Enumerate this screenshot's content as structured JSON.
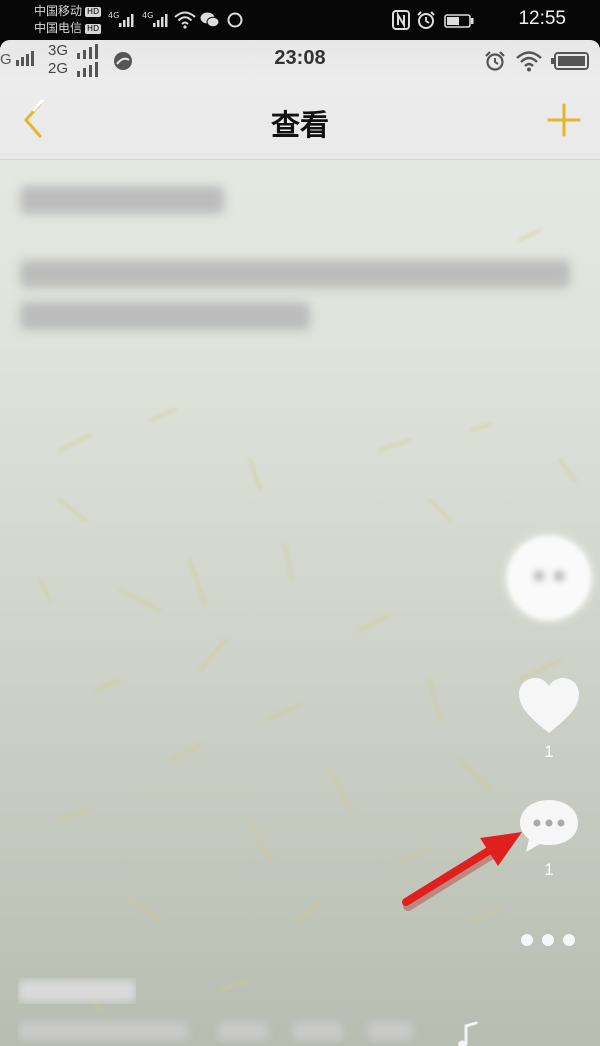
{
  "outer_status": {
    "carrier_1": "中国移动",
    "carrier_2": "中国电信",
    "hd_badge": "HD",
    "network_1": "4G",
    "network_2": "4G",
    "time": "12:55"
  },
  "inner_status": {
    "signal_3g": "3G",
    "signal_2g": "2G",
    "time": "23:08"
  },
  "nav": {
    "title": "查看"
  },
  "post": {
    "title_blurred": "████████",
    "body_blurred": "████████  ████████████ ██  ████████"
  },
  "actions": {
    "like_count": "1",
    "comment_count": "1"
  },
  "colors": {
    "accent_yellow": "#e8b923",
    "arrow_red": "#e0201c"
  },
  "icons": [
    "back-chevron-icon",
    "plus-icon",
    "heart-icon",
    "comment-bubble-icon",
    "more-dots-icon",
    "music-note-icon",
    "annotation-arrow"
  ]
}
